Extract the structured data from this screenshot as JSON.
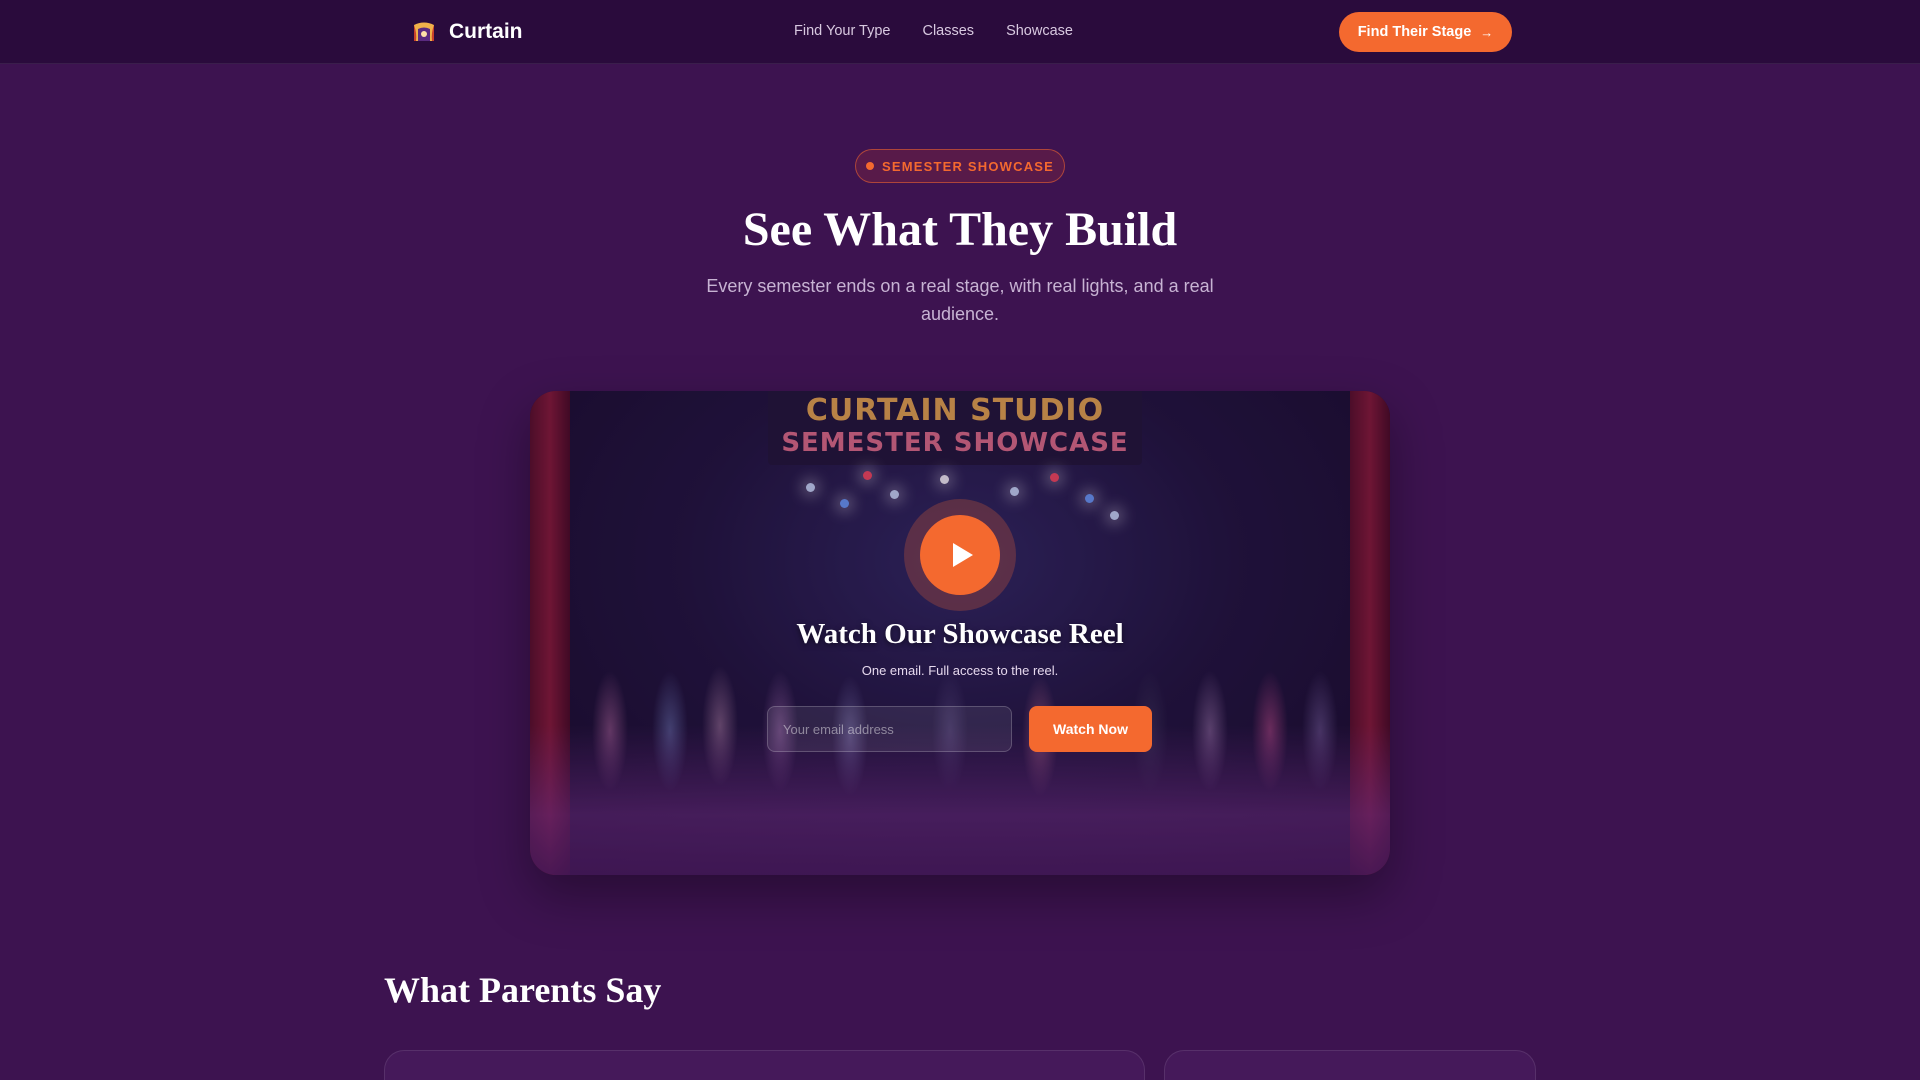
{
  "nav": {
    "brand": "Curtain",
    "links": [
      "Find Your Type",
      "Classes",
      "Showcase"
    ],
    "cta": "Find Their Stage"
  },
  "hero": {
    "badge": "SEMESTER SHOWCASE",
    "title": "See What They Build",
    "subtitle": "Every semester ends on a real stage, with real lights, and a real audience."
  },
  "video": {
    "banner_line1": "CURTAIN STUDIO",
    "banner_line2": "SEMESTER SHOWCASE",
    "title": "Watch Our Showcase Reel",
    "subtitle": "One email. Full access to the reel.",
    "email_placeholder": "Your email address",
    "button": "Watch Now"
  },
  "testimonials": {
    "title": "What Parents Say"
  },
  "colors": {
    "background": "#3d1350",
    "nav_background": "#2a0b3c",
    "accent": "#f4692f"
  }
}
